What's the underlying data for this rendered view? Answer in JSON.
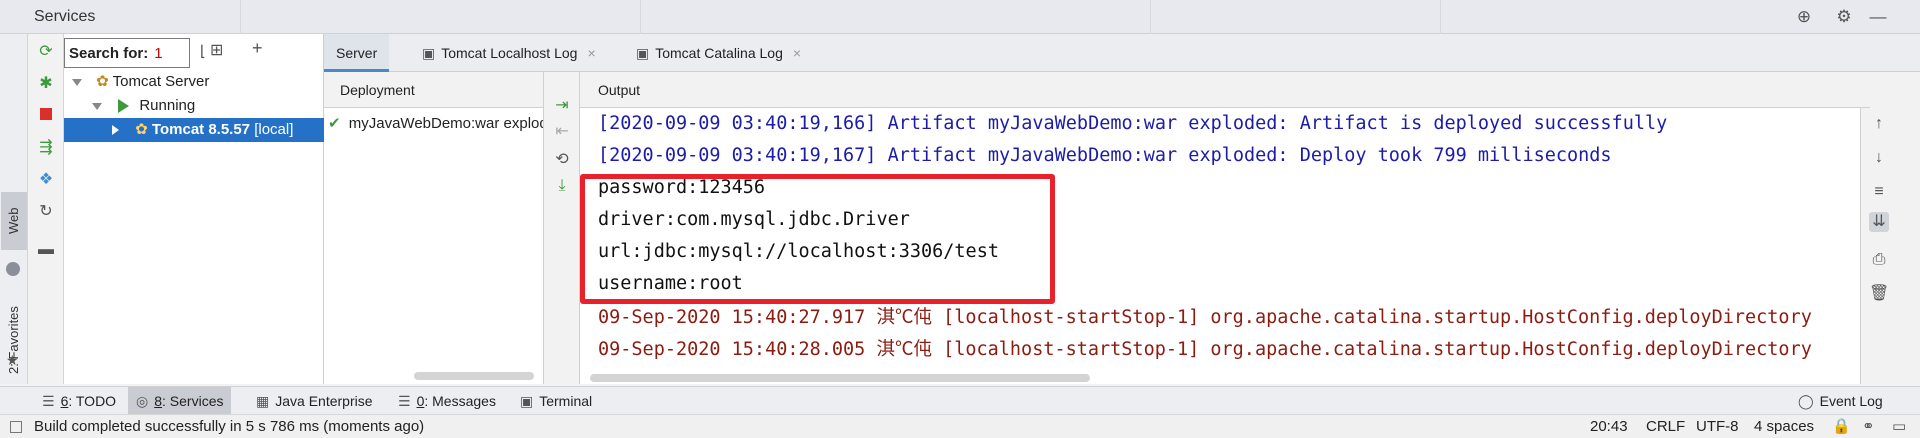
{
  "window": {
    "title": "Services"
  },
  "search": {
    "label": "Search for:",
    "count": "1"
  },
  "tree": {
    "root": "Tomcat Server",
    "group": "Running",
    "server_name": "Tomcat 8.5.57",
    "server_suffix": "[local]"
  },
  "tabs": [
    {
      "label": "Server"
    },
    {
      "label": "Tomcat Localhost Log"
    },
    {
      "label": "Tomcat Catalina Log"
    }
  ],
  "deployment": {
    "header": "Deployment",
    "items": [
      "myJavaWebDemo:war exploded"
    ]
  },
  "output": {
    "header": "Output",
    "lines": [
      "[2020-09-09 03:40:19,166] Artifact myJavaWebDemo:war exploded: Artifact is deployed successfully",
      "[2020-09-09 03:40:19,167] Artifact myJavaWebDemo:war exploded: Deploy took 799 milliseconds",
      "password:123456",
      "driver:com.mysql.jdbc.Driver",
      "url:jdbc:mysql://localhost:3306/test",
      "username:root",
      "09-Sep-2020 15:40:27.917 淇℃伅 [localhost-startStop-1] org.apache.catalina.startup.HostConfig.deployDirectory",
      "09-Sep-2020 15:40:28.005 淇℃伅 [localhost-startStop-1] org.apache.catalina.startup.HostConfig.deployDirectory"
    ]
  },
  "side_tabs": {
    "web": "Web",
    "favorites": "2: Favorites"
  },
  "bottom_tabs": [
    {
      "mnemonic": "6",
      "label": ": TODO"
    },
    {
      "mnemonic": "8",
      "label": ": Services"
    },
    {
      "mnemonic": "",
      "label": "Java Enterprise"
    },
    {
      "mnemonic": "0",
      "label": ": Messages"
    },
    {
      "mnemonic": "",
      "label": "Terminal"
    }
  ],
  "event_log": "Event Log",
  "status": {
    "message": "Build completed successfully in 5 s 786 ms (moments ago)",
    "position": "20:43",
    "line_sep": "CRLF",
    "encoding": "UTF-8",
    "indent": "4 spaces"
  },
  "colors": {
    "accent": "#2671c8",
    "highlight": "#e8212b",
    "run_green": "#3c9a3c"
  }
}
